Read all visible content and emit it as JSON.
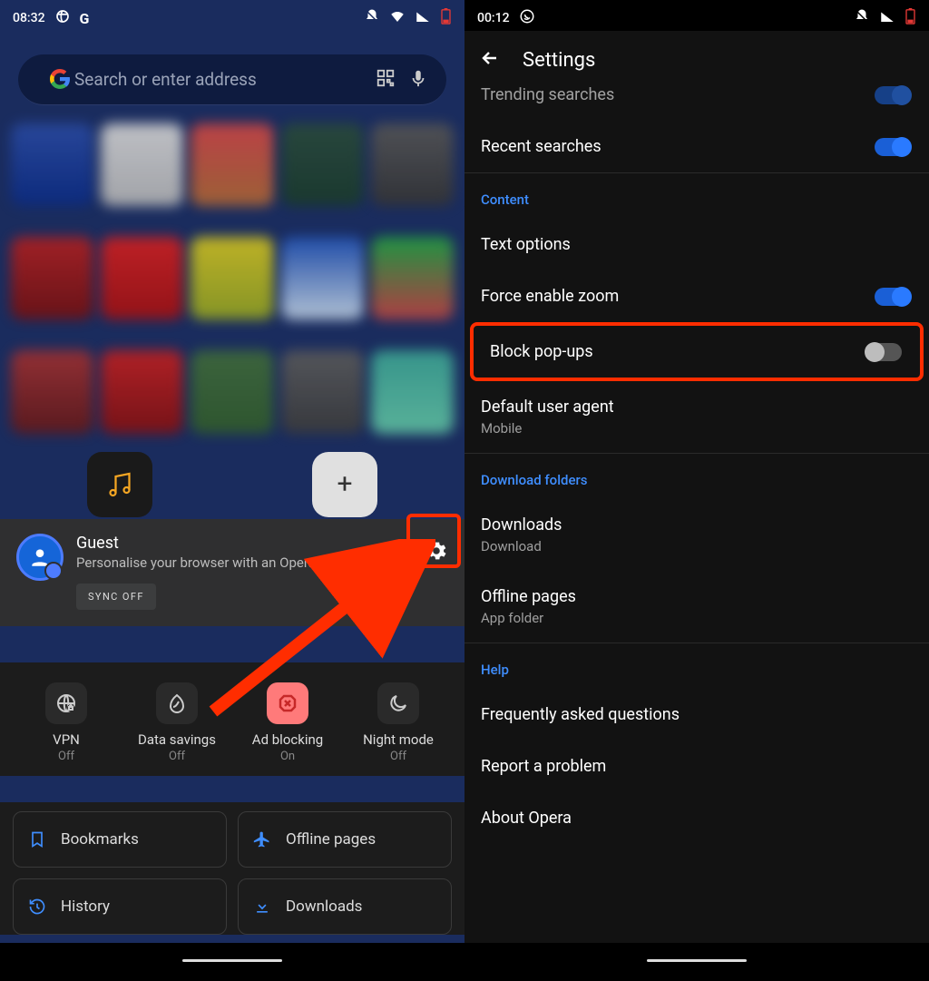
{
  "left": {
    "status": {
      "time": "08:32"
    },
    "search": {
      "placeholder": "Search or enter address"
    },
    "profile": {
      "name": "Guest",
      "desc": "Personalise your browser with an Opera account",
      "sync": "SYNC OFF"
    },
    "quick": {
      "vpn": {
        "label": "VPN",
        "state": "Off"
      },
      "data": {
        "label": "Data savings",
        "state": "Off"
      },
      "ad": {
        "label": "Ad blocking",
        "state": "On"
      },
      "night": {
        "label": "Night mode",
        "state": "Off"
      }
    },
    "rows": {
      "bookmarks": "Bookmarks",
      "offline": "Offline pages",
      "history": "History",
      "downloads": "Downloads"
    }
  },
  "right": {
    "status": {
      "time": "00:12"
    },
    "title": "Settings",
    "items": {
      "trending": "Trending searches",
      "recent": "Recent searches",
      "section_content": "Content",
      "text_options": "Text options",
      "force_zoom": "Force enable zoom",
      "block_popups": "Block pop-ups",
      "default_ua": "Default user agent",
      "default_ua_sub": "Mobile",
      "section_download": "Download folders",
      "downloads": "Downloads",
      "downloads_sub": "Download",
      "offline": "Offline pages",
      "offline_sub": "App folder",
      "section_help": "Help",
      "faq": "Frequently asked questions",
      "report": "Report a problem",
      "about": "About Opera"
    }
  }
}
